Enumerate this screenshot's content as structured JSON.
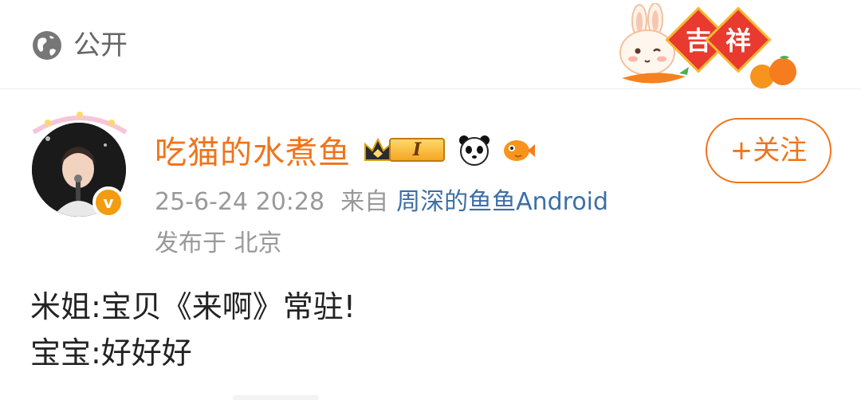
{
  "privacy": {
    "icon": "globe-icon",
    "label": "公开"
  },
  "author": {
    "name": "吃猫的水煮鱼",
    "verified_badge": "v",
    "level_badge": "I",
    "badges": [
      "crown-icon",
      "panda-icon",
      "fish-icon"
    ]
  },
  "post_meta": {
    "date": "25-6-24 20:28",
    "from_label": "来自",
    "source": "周深的鱼鱼Android",
    "location": "发布于 北京"
  },
  "follow_button": {
    "label": "+关注"
  },
  "decoration": {
    "label_1": "吉",
    "label_2": "祥"
  },
  "content": {
    "lines": [
      "米姐:宝贝《来啊》常驻!",
      "宝宝:好好好"
    ]
  },
  "colors": {
    "accent": "#f0741b",
    "link": "#3c6fa6",
    "muted": "#999999"
  }
}
